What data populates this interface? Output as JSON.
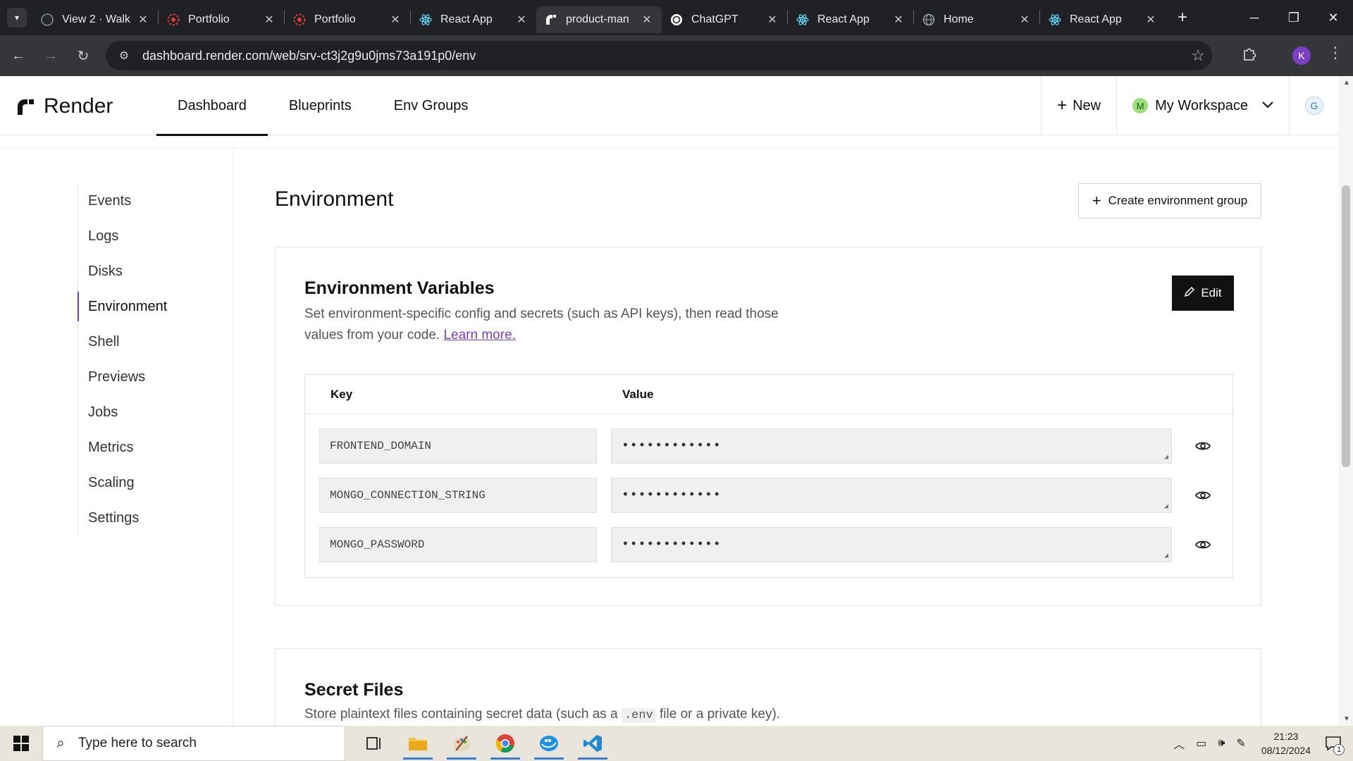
{
  "browser": {
    "tabs": [
      {
        "title": "View 2 · Walk",
        "icon": "github-icon",
        "active": false
      },
      {
        "title": "Portfolio",
        "icon": "angular-icon",
        "active": false
      },
      {
        "title": "Portfolio",
        "icon": "angular-icon",
        "active": false
      },
      {
        "title": "React App",
        "icon": "react-icon",
        "active": false
      },
      {
        "title": "product-man",
        "icon": "render-icon",
        "active": true
      },
      {
        "title": "ChatGPT",
        "icon": "chatgpt-icon",
        "active": false
      },
      {
        "title": "React App",
        "icon": "react-icon",
        "active": false
      },
      {
        "title": "Home",
        "icon": "globe-icon",
        "active": false
      },
      {
        "title": "React App",
        "icon": "react-icon",
        "active": false
      }
    ],
    "url": "dashboard.render.com/web/srv-ct3j2g9u0jms73a191p0/env",
    "profile_initial": "K"
  },
  "header": {
    "brand": "Render",
    "nav": [
      {
        "label": "Dashboard",
        "active": true
      },
      {
        "label": "Blueprints",
        "active": false
      },
      {
        "label": "Env Groups",
        "active": false
      }
    ],
    "new_label": "New",
    "workspace_badge": "M",
    "workspace_label": "My Workspace",
    "avatar_initial": "G"
  },
  "sidebar": {
    "items": [
      {
        "label": "Events",
        "active": false
      },
      {
        "label": "Logs",
        "active": false
      },
      {
        "label": "Disks",
        "active": false
      },
      {
        "label": "Environment",
        "active": true
      },
      {
        "label": "Shell",
        "active": false
      },
      {
        "label": "Previews",
        "active": false
      },
      {
        "label": "Jobs",
        "active": false
      },
      {
        "label": "Metrics",
        "active": false
      },
      {
        "label": "Scaling",
        "active": false
      },
      {
        "label": "Settings",
        "active": false
      }
    ]
  },
  "page": {
    "title": "Environment",
    "create_group_label": "Create environment group"
  },
  "env_vars": {
    "title": "Environment Variables",
    "desc_line1": "Set environment-specific config and secrets (such as API keys), then read those",
    "desc_line2": "values from your code.",
    "learn_more": "Learn more.",
    "edit_label": "Edit",
    "col_key": "Key",
    "col_value": "Value",
    "rows": [
      {
        "key": "FRONTEND_DOMAIN",
        "value": "••••••••••••"
      },
      {
        "key": "MONGO_CONNECTION_STRING",
        "value": "••••••••••••"
      },
      {
        "key": "MONGO_PASSWORD",
        "value": "••••••••••••"
      }
    ]
  },
  "secret_files": {
    "title": "Secret Files",
    "desc_before": "Store plaintext files containing secret data (such as a",
    "desc_code": ".env",
    "desc_after": "file or a private key)."
  },
  "taskbar": {
    "search_placeholder": "Type here to search",
    "time": "21:23",
    "date": "08/12/2024",
    "notification_count": "1"
  }
}
